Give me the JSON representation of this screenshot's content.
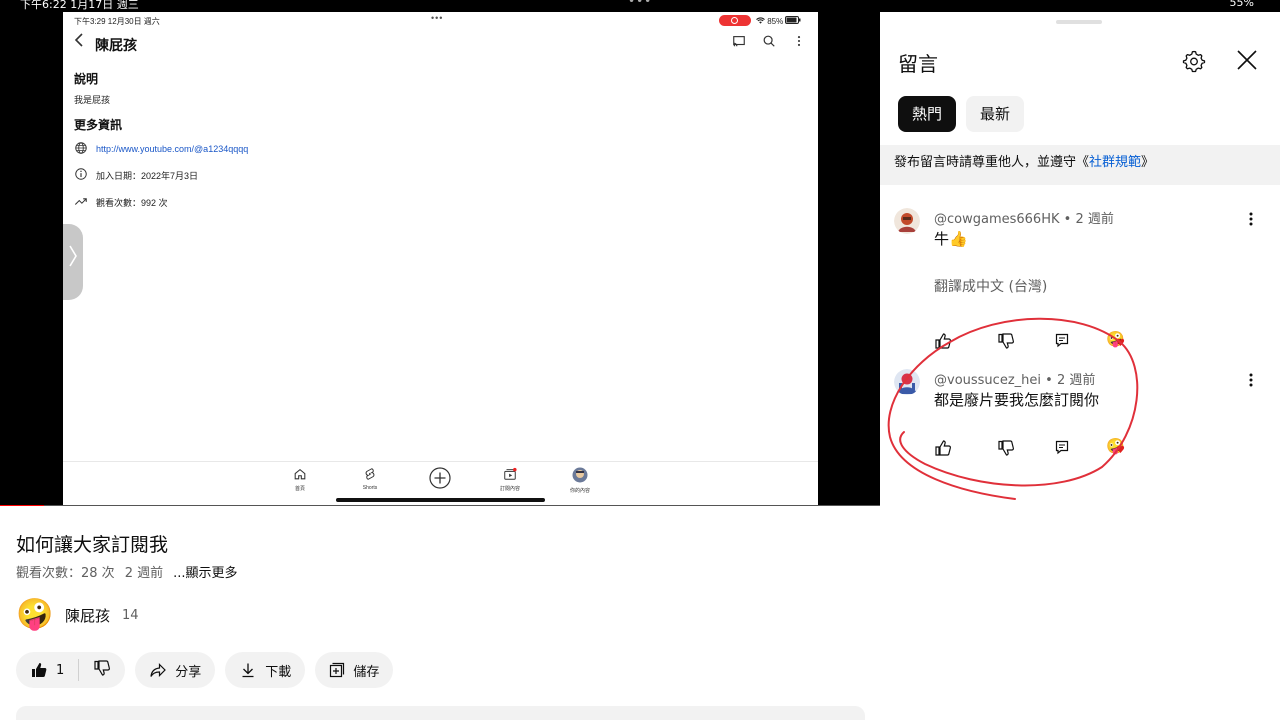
{
  "topbar": {
    "left": "下午6:22 1月17日 週三",
    "middle": "•••",
    "right": "55%"
  },
  "ipad": {
    "status_time": "下午3:29  12月30日 週六",
    "status_dots": "•••",
    "status_battery": "85%",
    "channel_name": "陳屁孩",
    "desc_title": "說明",
    "desc_text": "我是屁孩",
    "more_title": "更多資訊",
    "link": "http://www.youtube.com/@a1234qqqq",
    "joined": "加入日期：2022年7月3日",
    "views": "觀看次數：992 次",
    "tabs": [
      {
        "label": "首頁",
        "icon": "home-icon"
      },
      {
        "label": "Shorts",
        "icon": "shorts-icon"
      },
      {
        "label": "",
        "icon": "create-icon"
      },
      {
        "label": "訂閱內容",
        "icon": "subscriptions-icon"
      },
      {
        "label": "你的內容",
        "icon": "avatar-icon"
      }
    ]
  },
  "player": {
    "progress": 0.05,
    "colors": {
      "progress": "#ff0000",
      "track": "#555555"
    }
  },
  "video": {
    "title": "如何讓大家訂閱我",
    "views": "觀看次數：28 次",
    "age": "2 週前",
    "more": "...顯示更多",
    "channel": "陳屁孩",
    "subs": "14",
    "channel_avatar": "🤪",
    "likes": "1",
    "share": "分享",
    "download": "下載",
    "save": "儲存"
  },
  "comments_panel": {
    "title": "留言",
    "chip_top": "熱門",
    "chip_new": "最新",
    "rules_prefix": "發布留言時請尊重他人，並遵守《",
    "rules_link": "社群規範",
    "rules_suffix": "》",
    "items": [
      {
        "author": "@cowgames666HK",
        "age": "2 週前",
        "text": "牛👍",
        "translate": "翻譯成中文 (台灣)"
      },
      {
        "author": "@voussucez_hei",
        "age": "2 週前",
        "text": "都是廢片要我怎麼訂閱你",
        "translate": ""
      }
    ],
    "creator_heart_emoji": "🤪",
    "annotation_color": "#e0303a"
  }
}
